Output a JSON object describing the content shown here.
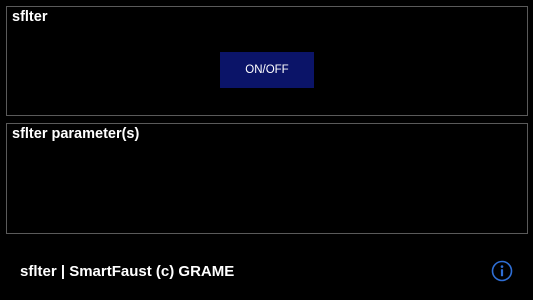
{
  "top_panel": {
    "title": "sflter",
    "toggle_label": "ON/OFF"
  },
  "params_panel": {
    "title": "sflter parameter(s)"
  },
  "footer": {
    "text": "sflter | SmartFaust (c) GRAME",
    "info_icon": "info-icon"
  },
  "colors": {
    "background": "#000000",
    "panel_border": "#5a5a5a",
    "button_bg": "#0b1468",
    "info_accent": "#2f6fd6",
    "text": "#ffffff"
  }
}
